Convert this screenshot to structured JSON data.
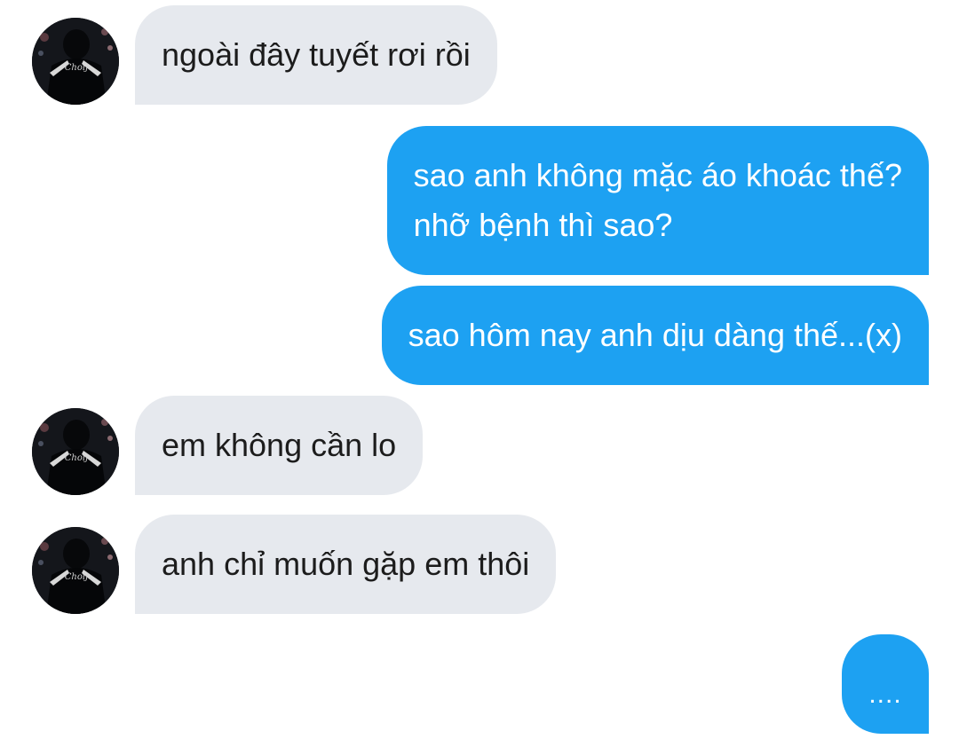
{
  "messages": [
    {
      "from": "them",
      "text": "ngoài đây tuyết rơi rồi"
    },
    {
      "from": "me",
      "lines": [
        "sao anh không mặc áo khoác thế?",
        "nhỡ bệnh thì sao?"
      ]
    },
    {
      "from": "me",
      "text": "sao hôm nay anh dịu dàng thế...(x)"
    },
    {
      "from": "them",
      "text": "em không cần lo"
    },
    {
      "from": "them",
      "text": "anh chỉ muốn gặp em thôi"
    }
  ],
  "typing_indicator": "....",
  "avatar": {
    "jersey_text": "Choij",
    "icon": "user-avatar-photo"
  },
  "colors": {
    "incoming_bubble": "#e6e9ee",
    "outgoing_bubble": "#1da1f2",
    "incoming_text": "#1c1c1c",
    "outgoing_text": "#ffffff"
  }
}
